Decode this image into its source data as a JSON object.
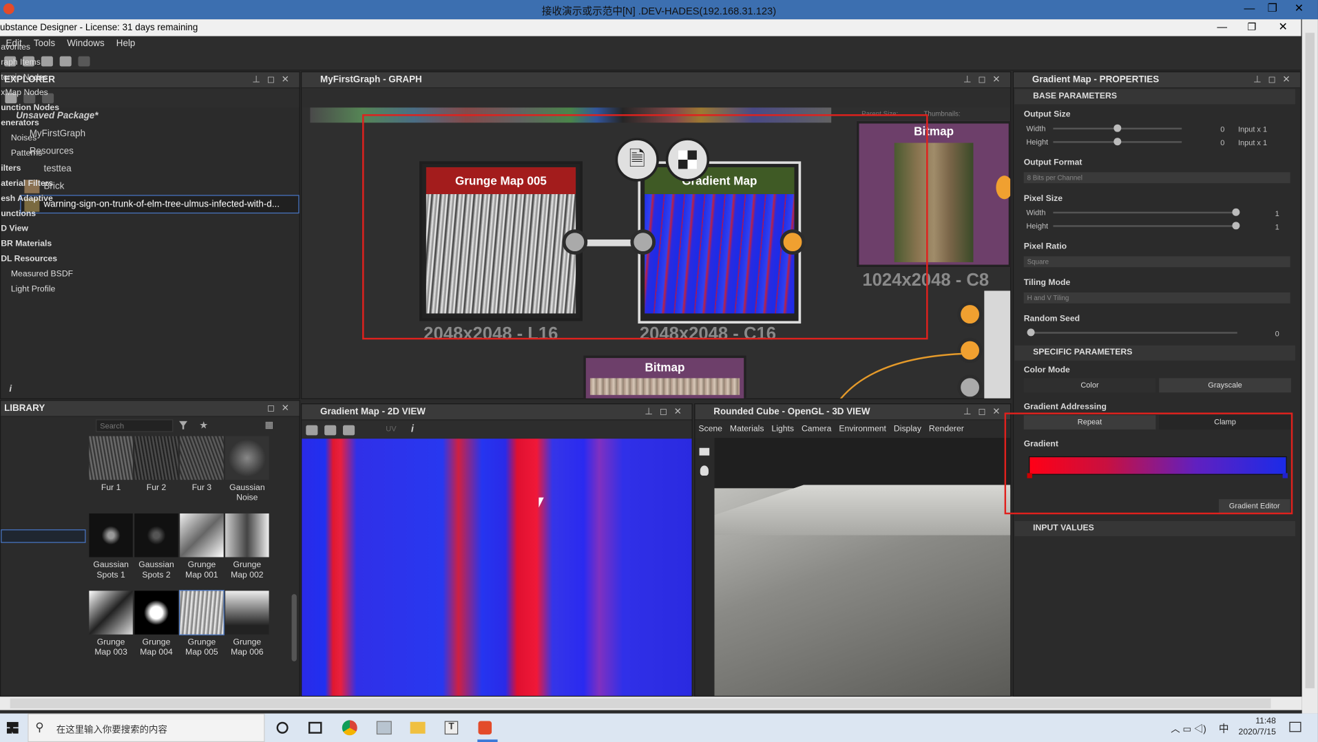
{
  "window": {
    "title": "接收演示或示范中[N] .DEV-HADES(192.168.31.123)",
    "app_title": "ubstance Designer - License: 31 days remaining"
  },
  "menu": [
    "Edit",
    "Tools",
    "Windows",
    "Help"
  ],
  "explorer": {
    "title": "EXPLORER",
    "package": "Unsaved Package*",
    "graph": "MyFirstGraph",
    "resources": "Resources",
    "items": [
      "testtea",
      "Brick",
      "warning-sign-on-trunk-of-elm-tree-ulmus-infected-with-d..."
    ],
    "info": "i"
  },
  "graph": {
    "title": "MyFirstGraph - GRAPH",
    "parent_size": "Parent Size:",
    "thumbnails": "Thumbnails:",
    "nodes": {
      "grunge": {
        "title": "Grunge Map 005",
        "res": "2048x2048 - L16"
      },
      "gradient": {
        "title": "Gradient Map",
        "res": "2048x2048 - C16"
      },
      "bitmap1": {
        "title": "Bitmap",
        "res": "1024x2048 - C8"
      },
      "bitmap2": {
        "title": "Bitmap"
      }
    }
  },
  "library": {
    "title": "LIBRARY",
    "search_placeholder": "Search",
    "categories": [
      "avorites",
      "raph Items",
      "tomic Nodes",
      "xMap Nodes",
      "unction Nodes",
      "enerators",
      "Noises",
      "Patterns",
      "ilters",
      "aterial Filters",
      "esh Adaptive",
      "unctions",
      "D View",
      "BR Materials",
      "DL Resources",
      "Measured BSDF",
      "Light Profile"
    ],
    "thumbs": [
      [
        "Fur 1",
        ""
      ],
      [
        "Fur 2",
        ""
      ],
      [
        "Fur 3",
        ""
      ],
      [
        "Gaussian",
        "Noise"
      ],
      [
        "Gaussian",
        "Spots 1"
      ],
      [
        "Gaussian",
        "Spots 2"
      ],
      [
        "Grunge",
        "Map 001"
      ],
      [
        "Grunge",
        "Map 002"
      ],
      [
        "Grunge",
        "Map 003"
      ],
      [
        "Grunge",
        "Map 004"
      ],
      [
        "Grunge",
        "Map 005"
      ],
      [
        "Grunge",
        "Map 006"
      ]
    ]
  },
  "view2d": {
    "title": "Gradient Map - 2D VIEW",
    "uv": "UV"
  },
  "view3d": {
    "title": "Rounded Cube - OpenGL - 3D VIEW",
    "menu": [
      "Scene",
      "Materials",
      "Lights",
      "Camera",
      "Environment",
      "Display",
      "Renderer"
    ]
  },
  "properties": {
    "title": "Gradient Map - PROPERTIES",
    "base": "BASE PARAMETERS",
    "output_size": {
      "label": "Output Size",
      "width": "Width",
      "height": "Height",
      "w_val": "0",
      "h_val": "0",
      "w_suffix": "Input x 1",
      "h_suffix": "Input x 1"
    },
    "output_format": {
      "label": "Output Format",
      "value": "8 Bits per Channel"
    },
    "pixel_size": {
      "label": "Pixel Size",
      "width": "Width",
      "height": "Height",
      "w_val": "1",
      "h_val": "1"
    },
    "pixel_ratio": {
      "label": "Pixel Ratio",
      "value": "Square"
    },
    "tiling": {
      "label": "Tiling Mode",
      "value": "H and V Tiling"
    },
    "seed": {
      "label": "Random Seed",
      "value": "0"
    },
    "specific": "SPECIFIC PARAMETERS",
    "color_mode": {
      "label": "Color Mode",
      "opt1": "Color",
      "opt2": "Grayscale"
    },
    "addressing": {
      "label": "Gradient Addressing",
      "opt1": "Repeat",
      "opt2": "Clamp"
    },
    "gradient_label": "Gradient",
    "gradient_editor": "Gradient Editor",
    "input_values": "INPUT VALUES"
  },
  "taskbar": {
    "search": "在这里输入你要搜索的内容",
    "time": "11:48",
    "date": "2020/7/15",
    "ime": "中"
  }
}
